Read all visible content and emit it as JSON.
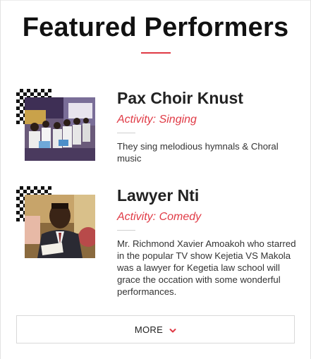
{
  "section": {
    "title": "Featured Performers"
  },
  "performers": [
    {
      "name": "Pax Choir Knust",
      "activity": "Activity: Singing",
      "description": "They sing melodious hymnals & Choral music"
    },
    {
      "name": "Lawyer Nti",
      "activity": "Activity: Comedy",
      "description": "Mr. Richmond Xavier Amoakoh who starred in the popular TV show Kejetia VS Makola was a lawyer for Kegetia law school will grace the occation with some wonderful performances."
    }
  ],
  "more_button": {
    "label": "MORE",
    "icon": "chevron-down-icon"
  },
  "colors": {
    "accent": "#e03a45",
    "title": "#111111",
    "text": "#333333"
  }
}
